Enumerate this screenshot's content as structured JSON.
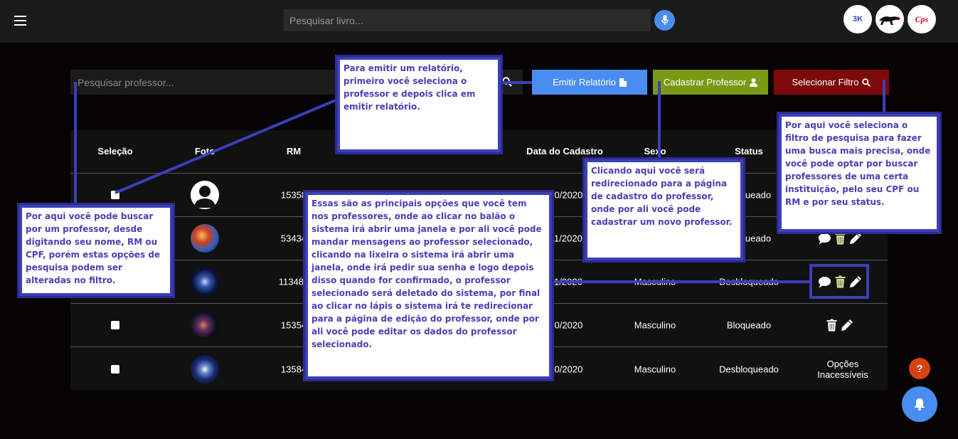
{
  "topbar": {
    "book_search_placeholder": "Pesquisar livro...",
    "logo1_text": "3K",
    "logo3_text": "Cps"
  },
  "toolbar": {
    "professor_search_placeholder": "Pesquisar professor...",
    "report_label": "Emitir Relatório",
    "register_label": "Cadastrar Professor",
    "filter_label": "Selecionar Filtro"
  },
  "table": {
    "headers": {
      "selection": "Seleção",
      "photo": "Foto",
      "rm": "RM",
      "date": "Data do Cadastro",
      "sex": "Sexo",
      "status": "Status"
    },
    "rows": [
      {
        "rm": "15358",
        "date": "/10/2020",
        "sex": "",
        "status": "Bloqueado"
      },
      {
        "rm": "53434",
        "date": "/11/2020",
        "sex": "",
        "status": "Bloqueado"
      },
      {
        "rm": "113483",
        "date": "/11/2020",
        "sex": "Masculino",
        "status": "Desbloqueado"
      },
      {
        "rm": "15354",
        "date": "/10/2020",
        "sex": "Masculino",
        "status": "Bloqueado"
      },
      {
        "rm": "13584",
        "date": "/10/2020",
        "sex": "Masculino",
        "status": "Desbloqueado",
        "options_text_1": "Opções",
        "options_text_2": "Inacessíveis"
      }
    ]
  },
  "notes": {
    "report": "Para emitir um relatório, primeiro você seleciona o professor e depois clica em emitir relatório.",
    "search": "Por aqui você pode buscar por um professor, desde digitando seu nome, RM ou CPF, porém estas opções de pesquisa podem ser alteradas no filtro.",
    "actions": "Essas são as principais opções que você tem nos professores, onde ao clicar no balão o sistema irá abrir uma janela e por ali você pode mandar mensagens ao professor selecionado, clicando na lixeira o sistema irá abrir uma janela, onde irá pedir sua senha e logo depois disso quando for confirmado, o professor selecionado será deletado do sistema, por final ao clicar no lápis o sistema irá te redirecionar para a página de edição do professor, onde por ali você pode editar os dados do professor selecionado.",
    "register": "Clicando aqui você será redirecionado para a página de cadastro do professor, onde por ali você pode cadastrar um novo professor.",
    "filter": "Por aqui você seleciona o filtro de pesquisa para fazer uma busca mais precisa, onde você pode optar por buscar professores de uma certa instituição, pelo seu CPF ou RM e por seu status."
  },
  "floating": {
    "help_label": "?"
  },
  "colors": {
    "report_button": "#4a8df0",
    "register_button": "#7a9a13",
    "filter_button": "#7d0a0a",
    "note_border": "#3b3fb8",
    "note_text": "#4b3fb5"
  }
}
